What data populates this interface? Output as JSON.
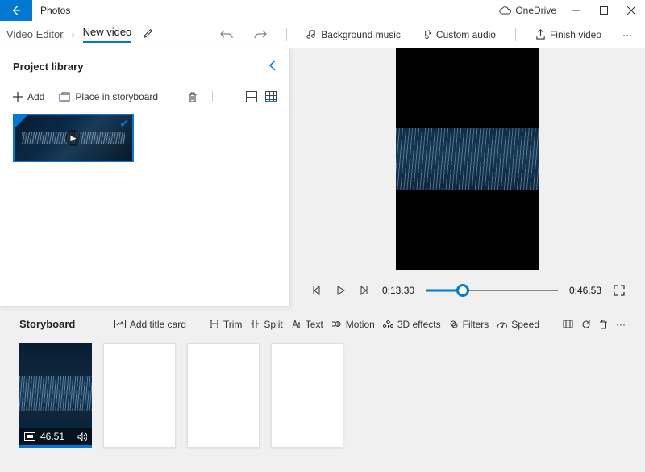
{
  "titlebar": {
    "app_name": "Photos",
    "onedrive_label": "OneDrive"
  },
  "breadcrumb": {
    "root": "Video Editor",
    "current": "New video"
  },
  "top_toolbar": {
    "bg_music": "Background music",
    "custom_audio": "Custom audio",
    "finish": "Finish video"
  },
  "library": {
    "title": "Project library",
    "add_label": "Add",
    "place_label": "Place in storyboard"
  },
  "playback": {
    "current_time": "0:13.30",
    "total_time": "0:46.53",
    "progress_pct": 28
  },
  "storyboard": {
    "title": "Storyboard",
    "tools": {
      "title_card": "Add title card",
      "trim": "Trim",
      "split": "Split",
      "text": "Text",
      "motion": "Motion",
      "effects": "3D effects",
      "filters": "Filters",
      "speed": "Speed"
    },
    "clip_duration": "46.51"
  }
}
